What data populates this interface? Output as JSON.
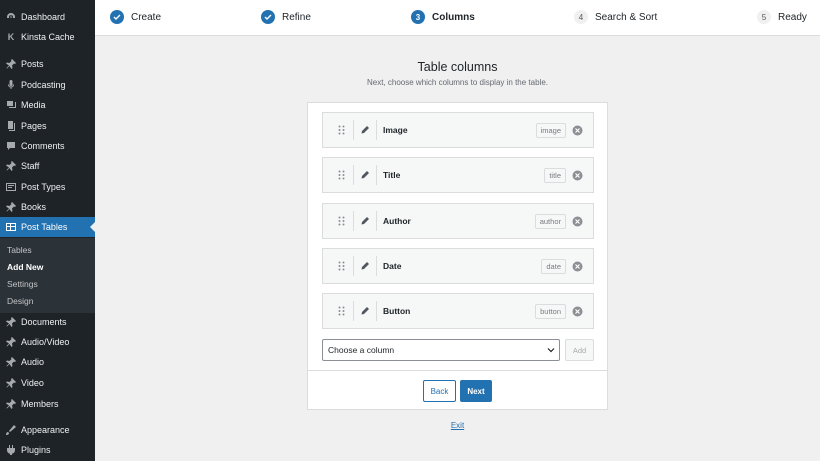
{
  "sidebar": {
    "items": [
      {
        "label": "Dashboard",
        "icon": "dashboard-icon"
      },
      {
        "label": "Kinsta Cache",
        "icon": "kinsta-icon"
      },
      {
        "label": "Posts",
        "icon": "pin-icon"
      },
      {
        "label": "Podcasting",
        "icon": "microphone-icon"
      },
      {
        "label": "Media",
        "icon": "media-icon"
      },
      {
        "label": "Pages",
        "icon": "pages-icon"
      },
      {
        "label": "Comments",
        "icon": "comments-icon"
      },
      {
        "label": "Staff",
        "icon": "pin-icon"
      },
      {
        "label": "Post Types",
        "icon": "post-types-icon"
      },
      {
        "label": "Books",
        "icon": "pin-icon"
      },
      {
        "label": "Post Tables",
        "icon": "table-icon",
        "active": true
      },
      {
        "label": "Documents",
        "icon": "pin-icon"
      },
      {
        "label": "Audio/Video",
        "icon": "pin-icon"
      },
      {
        "label": "Audio",
        "icon": "pin-icon"
      },
      {
        "label": "Video",
        "icon": "pin-icon"
      },
      {
        "label": "Members",
        "icon": "pin-icon"
      },
      {
        "label": "Appearance",
        "icon": "appearance-icon"
      },
      {
        "label": "Plugins",
        "icon": "plugins-icon"
      }
    ],
    "submenu": [
      {
        "label": "Tables"
      },
      {
        "label": "Add New",
        "current": true
      },
      {
        "label": "Settings"
      },
      {
        "label": "Design"
      }
    ]
  },
  "stepper": {
    "steps": [
      {
        "number": "1",
        "label": "Create",
        "state": "done"
      },
      {
        "number": "2",
        "label": "Refine",
        "state": "done"
      },
      {
        "number": "3",
        "label": "Columns",
        "state": "current"
      },
      {
        "number": "4",
        "label": "Search & Sort",
        "state": "future"
      },
      {
        "number": "5",
        "label": "Ready",
        "state": "future"
      }
    ]
  },
  "main": {
    "title": "Table columns",
    "subtitle": "Next, choose which columns to display in the table.",
    "columns": [
      {
        "name": "Image",
        "tag": "image"
      },
      {
        "name": "Title",
        "tag": "title"
      },
      {
        "name": "Author",
        "tag": "author"
      },
      {
        "name": "Date",
        "tag": "date"
      },
      {
        "name": "Button",
        "tag": "button"
      }
    ],
    "choose_placeholder": "Choose a column",
    "add_label": "Add",
    "back_label": "Back",
    "next_label": "Next",
    "exit_label": "Exit"
  },
  "colors": {
    "accent": "#2271b1",
    "sidebar_bg": "#1d2327",
    "submenu_bg": "#2c3338"
  }
}
